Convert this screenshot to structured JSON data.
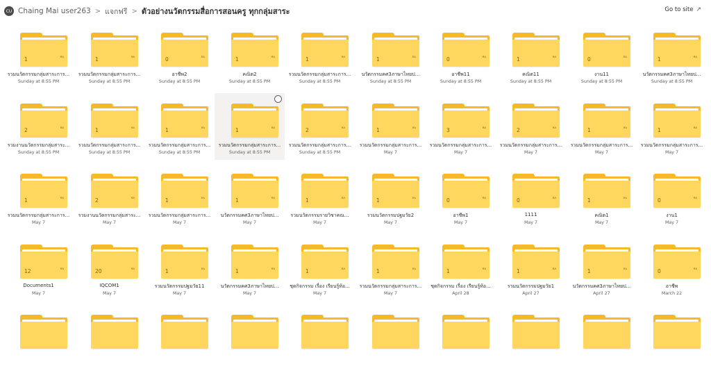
{
  "header": {
    "avatar_initials": "CU",
    "site": "Chaing Mai user263",
    "separator": ">",
    "library": "แจกฟรี",
    "current_folder": "ตัวอย่างนวัตกรรมสื่อการสอนครู ทุกกลุ่มสาระ",
    "goto_label": "Go to site",
    "goto_icon": "arrow-up-right-icon"
  },
  "colors": {
    "folder_back": "#f7b92a",
    "folder_front": "#ffd75e",
    "selected_bg": "#f3f2f1"
  },
  "folders": [
    {
      "count": "1",
      "name": "รวมนวัตกรรมกลุ่มสาระการ...",
      "date": "Sunday at 8:55 PM"
    },
    {
      "count": "1",
      "name": "รวมนวัตกรรมกลุ่มสาระการ...",
      "date": "Sunday at 8:55 PM"
    },
    {
      "count": "0",
      "name": "อาชีพ2",
      "date": "Sunday at 8:55 PM"
    },
    {
      "count": "1",
      "name": "คณิต2",
      "date": "Sunday at 8:55 PM"
    },
    {
      "count": "1",
      "name": "รวมนวัตกรรมกลุ่มสาระการ...",
      "date": "Sunday at 8:55 PM"
    },
    {
      "count": "1",
      "name": "นวัตกรรมคศ3ภาษาไทยป...",
      "date": "Sunday at 8:55 PM"
    },
    {
      "count": "0",
      "name": "อาชีพ11",
      "date": "Sunday at 8:55 PM"
    },
    {
      "count": "1",
      "name": "คณิต11",
      "date": "Sunday at 8:55 PM"
    },
    {
      "count": "0",
      "name": "งาน11",
      "date": "Sunday at 8:55 PM"
    },
    {
      "count": "1",
      "name": "นวัตกรรมคศ3ภาษาไทยป...",
      "date": "Sunday at 8:55 PM"
    },
    {
      "count": "2",
      "name": "รวมงานนวัตกรรมกลุ่มสาระ...",
      "date": "Sunday at 8:55 PM"
    },
    {
      "count": "1",
      "name": "รวมนวัตกรรมกลุ่มสาระการ...",
      "date": "Sunday at 8:55 PM"
    },
    {
      "count": "1",
      "name": "รวมนวัตกรรมกลุ่มสาระการ...",
      "date": "Sunday at 8:55 PM"
    },
    {
      "count": "1",
      "name": "รวมนวัตกรรมกลุ่มสาระการ...",
      "date": "Sunday at 8:55 PM",
      "selected": true
    },
    {
      "count": "2",
      "name": "รวมนวัตกรรมกลุ่มสาระการ...",
      "date": "Sunday at 8:55 PM"
    },
    {
      "count": "1",
      "name": "รวมนวัตกรรมกลุ่มสาระการ...",
      "date": "May 7"
    },
    {
      "count": "3",
      "name": "รวมนวัตกรรมกลุ่มสาระการ...",
      "date": "May 7"
    },
    {
      "count": "2",
      "name": "รวมนวัตกรรมกลุ่มสาระการ...",
      "date": "May 7"
    },
    {
      "count": "1",
      "name": "รวมนวัตกรรมกลุ่มสาระการ...",
      "date": "May 7"
    },
    {
      "count": "1",
      "name": "รวมนวัตกรรมกลุ่มสาระการ...",
      "date": "May 7"
    },
    {
      "count": "1",
      "name": "รวมนวัตกรรมกลุ่มสาระการ...",
      "date": "May 7"
    },
    {
      "count": "2",
      "name": "รวมงานนวัตกรรมกลุ่มสาระ...",
      "date": "May 7"
    },
    {
      "count": "1",
      "name": "รวมนวัตกรรมกลุ่มสาระการ...",
      "date": "May 7"
    },
    {
      "count": "1",
      "name": "นวัตกรรมคศ3ภาษาไทยป...",
      "date": "May 7"
    },
    {
      "count": "1",
      "name": "รวมนวัตกรรมรายวิชาคณ...",
      "date": "May 7"
    },
    {
      "count": "1",
      "name": "รวมนวัตกรรมปฐมวัย2",
      "date": "May 7"
    },
    {
      "count": "0",
      "name": "อาชีพ1",
      "date": "May 7"
    },
    {
      "count": "0",
      "name": "1111",
      "date": "May 7"
    },
    {
      "count": "1",
      "name": "คณิต1",
      "date": "May 7"
    },
    {
      "count": "0",
      "name": "งาน1",
      "date": "May 7"
    },
    {
      "count": "12",
      "name": "Documents1",
      "date": "May 7"
    },
    {
      "count": "20",
      "name": "IQCOM1",
      "date": "May 7"
    },
    {
      "count": "1",
      "name": "รวมนวัตกรรมปฐมวัย11",
      "date": "May 7"
    },
    {
      "count": "1",
      "name": "นวัตกรรมคศ3ภาษาไทยป...",
      "date": "May 7"
    },
    {
      "count": "1",
      "name": "ชุดกิจกรรม เรื่อง เรียนรู้ท้อ...",
      "date": "May 7"
    },
    {
      "count": "1",
      "name": "รวมนวัตกรรมกลุ่มสาระการ...",
      "date": "May 7"
    },
    {
      "count": "1",
      "name": "ชุดกิจกรรม เรื่อง เรียนรู้ท้อ...",
      "date": "April 28"
    },
    {
      "count": "1",
      "name": "รวมนวัตกรรมปฐมวัย1",
      "date": "April 27"
    },
    {
      "count": "1",
      "name": "นวัตกรรมคศ3ภาษาไทยป...",
      "date": "April 27"
    },
    {
      "count": "0",
      "name": "อาชีพ",
      "date": "March 22"
    },
    {
      "count": "",
      "name": "",
      "date": ""
    },
    {
      "count": "",
      "name": "",
      "date": ""
    },
    {
      "count": "",
      "name": "",
      "date": ""
    },
    {
      "count": "",
      "name": "",
      "date": ""
    },
    {
      "count": "",
      "name": "",
      "date": ""
    },
    {
      "count": "",
      "name": "",
      "date": ""
    },
    {
      "count": "",
      "name": "",
      "date": ""
    },
    {
      "count": "",
      "name": "",
      "date": ""
    },
    {
      "count": "",
      "name": "",
      "date": ""
    },
    {
      "count": "",
      "name": "",
      "date": ""
    }
  ]
}
